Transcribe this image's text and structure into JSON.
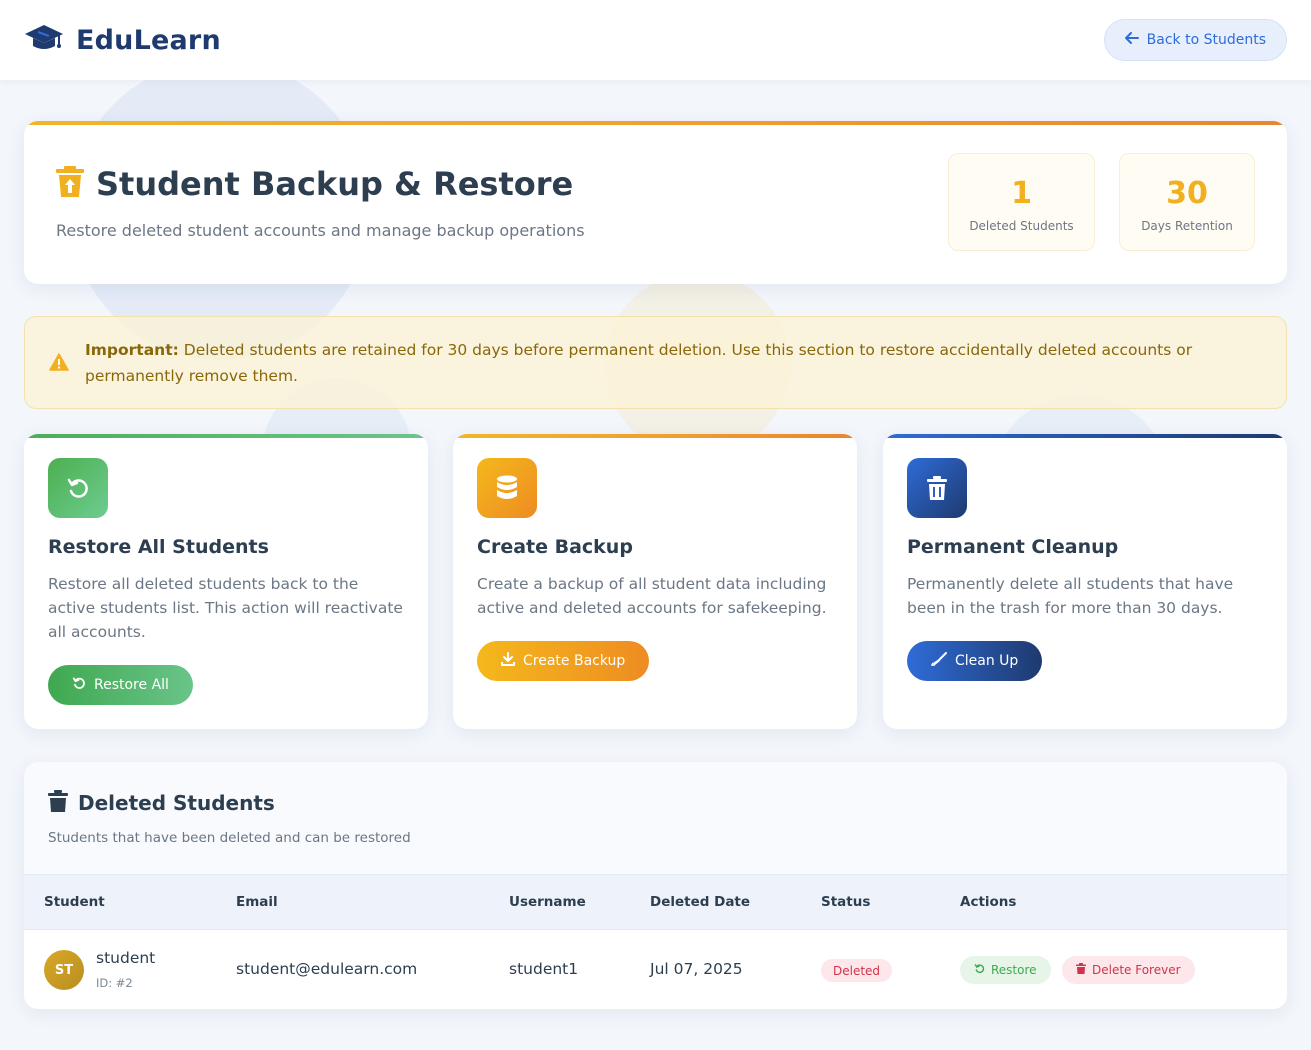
{
  "brand": {
    "name": "EduLearn",
    "icon": "graduation-cap-icon"
  },
  "topbar": {
    "back_label": "Back to Students",
    "back_icon": "arrow-left-icon"
  },
  "header": {
    "icon": "trash-restore-icon",
    "title": "Student Backup & Restore",
    "subtitle": "Restore deleted student accounts and manage backup operations",
    "stats": [
      {
        "value": "1",
        "label": "Deleted Students"
      },
      {
        "value": "30",
        "label": "Days Retention"
      }
    ]
  },
  "alert": {
    "icon": "warning-triangle-icon",
    "strong": "Important:",
    "text": " Deleted students are retained for 30 days before permanent deletion. Use this section to restore accidentally deleted accounts or permanently remove them."
  },
  "actions": [
    {
      "icon": "undo-icon",
      "title": "Restore All Students",
      "description": "Restore all deleted students back to the active students list. This action will reactivate all accounts.",
      "button_label": "Restore All",
      "button_icon": "undo-icon"
    },
    {
      "icon": "database-icon",
      "title": "Create Backup",
      "description": "Create a backup of all student data including active and deleted accounts for safekeeping.",
      "button_label": "Create Backup",
      "button_icon": "download-icon"
    },
    {
      "icon": "trash-icon",
      "title": "Permanent Cleanup",
      "description": "Permanently delete all students that have been in the trash for more than 30 days.",
      "button_label": "Clean Up",
      "button_icon": "broom-icon"
    }
  ],
  "deleted": {
    "icon": "trash-icon",
    "title": "Deleted Students",
    "subtitle": "Students that have been deleted and can be restored",
    "columns": [
      "Student",
      "Email",
      "Username",
      "Deleted Date",
      "Status",
      "Actions"
    ],
    "rows": [
      {
        "initials": "ST",
        "name": "student",
        "id": "ID: #2",
        "email": "student@edulearn.com",
        "username": "student1",
        "deleted_date": "Jul 07, 2025",
        "status": "Deleted",
        "restore_label": "Restore",
        "delete_label": "Delete Forever"
      }
    ]
  },
  "colors": {
    "brand": "#1e3a6e",
    "accent_blue": "#2f6cd8",
    "gold": "#f0b020",
    "green": "#3fa84f",
    "danger": "#d0344a"
  }
}
